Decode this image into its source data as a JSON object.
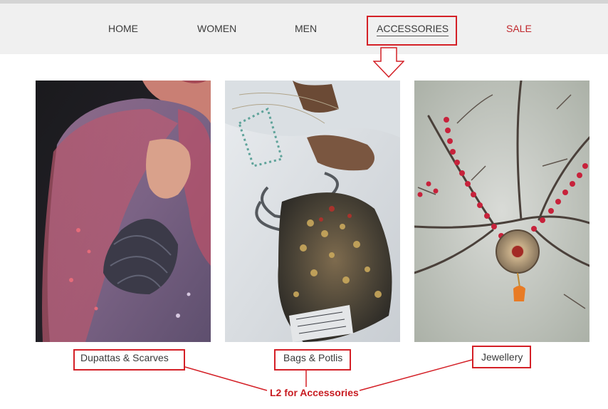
{
  "nav": {
    "items": [
      {
        "label": "HOME"
      },
      {
        "label": "WOMEN"
      },
      {
        "label": "MEN"
      },
      {
        "label": "ACCESSORIES",
        "active": true
      },
      {
        "label": "SALE",
        "color": "#c0282d"
      }
    ]
  },
  "categories": [
    {
      "label": "Dupattas & Scarves",
      "image": "dupatta-image"
    },
    {
      "label": "Bags & Potlis",
      "image": "potli-bag-image"
    },
    {
      "label": "Jewellery",
      "image": "necklace-image"
    }
  ],
  "annotation": {
    "label": "L2 for Accessories",
    "color": "#d42027"
  }
}
